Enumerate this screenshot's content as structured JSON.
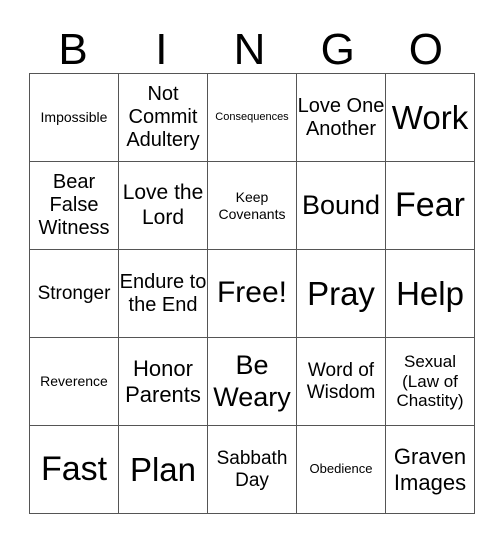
{
  "header": [
    "B",
    "I",
    "N",
    "G",
    "O"
  ],
  "cells": [
    [
      "Impossible",
      "Not Commit Adultery",
      "Consequences",
      "Love One Another",
      "Work"
    ],
    [
      "Bear False Witness",
      "Love the Lord",
      "Keep Covenants",
      "Bound",
      "Fear"
    ],
    [
      "Stronger",
      "Endure to the End",
      "Free!",
      "Pray",
      "Help"
    ],
    [
      "Reverence",
      "Honor Parents",
      "Be Weary",
      "Word of Wisdom",
      "Sexual (Law of Chastity)"
    ],
    [
      "Fast",
      "Plan",
      "Sabbath Day",
      "Obedience",
      "Graven Images"
    ]
  ]
}
